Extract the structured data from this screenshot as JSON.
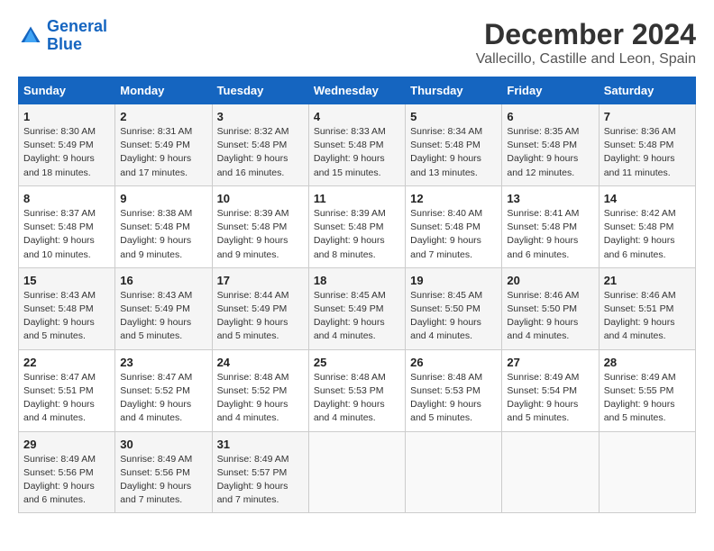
{
  "logo": {
    "line1": "General",
    "line2": "Blue"
  },
  "title": "December 2024",
  "subtitle": "Vallecillo, Castille and Leon, Spain",
  "days_of_week": [
    "Sunday",
    "Monday",
    "Tuesday",
    "Wednesday",
    "Thursday",
    "Friday",
    "Saturday"
  ],
  "weeks": [
    [
      {
        "day": "1",
        "sunrise": "8:30 AM",
        "sunset": "5:49 PM",
        "daylight": "9 hours and 18 minutes."
      },
      {
        "day": "2",
        "sunrise": "8:31 AM",
        "sunset": "5:49 PM",
        "daylight": "9 hours and 17 minutes."
      },
      {
        "day": "3",
        "sunrise": "8:32 AM",
        "sunset": "5:48 PM",
        "daylight": "9 hours and 16 minutes."
      },
      {
        "day": "4",
        "sunrise": "8:33 AM",
        "sunset": "5:48 PM",
        "daylight": "9 hours and 15 minutes."
      },
      {
        "day": "5",
        "sunrise": "8:34 AM",
        "sunset": "5:48 PM",
        "daylight": "9 hours and 13 minutes."
      },
      {
        "day": "6",
        "sunrise": "8:35 AM",
        "sunset": "5:48 PM",
        "daylight": "9 hours and 12 minutes."
      },
      {
        "day": "7",
        "sunrise": "8:36 AM",
        "sunset": "5:48 PM",
        "daylight": "9 hours and 11 minutes."
      }
    ],
    [
      {
        "day": "8",
        "sunrise": "8:37 AM",
        "sunset": "5:48 PM",
        "daylight": "9 hours and 10 minutes."
      },
      {
        "day": "9",
        "sunrise": "8:38 AM",
        "sunset": "5:48 PM",
        "daylight": "9 hours and 9 minutes."
      },
      {
        "day": "10",
        "sunrise": "8:39 AM",
        "sunset": "5:48 PM",
        "daylight": "9 hours and 9 minutes."
      },
      {
        "day": "11",
        "sunrise": "8:39 AM",
        "sunset": "5:48 PM",
        "daylight": "9 hours and 8 minutes."
      },
      {
        "day": "12",
        "sunrise": "8:40 AM",
        "sunset": "5:48 PM",
        "daylight": "9 hours and 7 minutes."
      },
      {
        "day": "13",
        "sunrise": "8:41 AM",
        "sunset": "5:48 PM",
        "daylight": "9 hours and 6 minutes."
      },
      {
        "day": "14",
        "sunrise": "8:42 AM",
        "sunset": "5:48 PM",
        "daylight": "9 hours and 6 minutes."
      }
    ],
    [
      {
        "day": "15",
        "sunrise": "8:43 AM",
        "sunset": "5:48 PM",
        "daylight": "9 hours and 5 minutes."
      },
      {
        "day": "16",
        "sunrise": "8:43 AM",
        "sunset": "5:49 PM",
        "daylight": "9 hours and 5 minutes."
      },
      {
        "day": "17",
        "sunrise": "8:44 AM",
        "sunset": "5:49 PM",
        "daylight": "9 hours and 5 minutes."
      },
      {
        "day": "18",
        "sunrise": "8:45 AM",
        "sunset": "5:49 PM",
        "daylight": "9 hours and 4 minutes."
      },
      {
        "day": "19",
        "sunrise": "8:45 AM",
        "sunset": "5:50 PM",
        "daylight": "9 hours and 4 minutes."
      },
      {
        "day": "20",
        "sunrise": "8:46 AM",
        "sunset": "5:50 PM",
        "daylight": "9 hours and 4 minutes."
      },
      {
        "day": "21",
        "sunrise": "8:46 AM",
        "sunset": "5:51 PM",
        "daylight": "9 hours and 4 minutes."
      }
    ],
    [
      {
        "day": "22",
        "sunrise": "8:47 AM",
        "sunset": "5:51 PM",
        "daylight": "9 hours and 4 minutes."
      },
      {
        "day": "23",
        "sunrise": "8:47 AM",
        "sunset": "5:52 PM",
        "daylight": "9 hours and 4 minutes."
      },
      {
        "day": "24",
        "sunrise": "8:48 AM",
        "sunset": "5:52 PM",
        "daylight": "9 hours and 4 minutes."
      },
      {
        "day": "25",
        "sunrise": "8:48 AM",
        "sunset": "5:53 PM",
        "daylight": "9 hours and 4 minutes."
      },
      {
        "day": "26",
        "sunrise": "8:48 AM",
        "sunset": "5:53 PM",
        "daylight": "9 hours and 5 minutes."
      },
      {
        "day": "27",
        "sunrise": "8:49 AM",
        "sunset": "5:54 PM",
        "daylight": "9 hours and 5 minutes."
      },
      {
        "day": "28",
        "sunrise": "8:49 AM",
        "sunset": "5:55 PM",
        "daylight": "9 hours and 5 minutes."
      }
    ],
    [
      {
        "day": "29",
        "sunrise": "8:49 AM",
        "sunset": "5:56 PM",
        "daylight": "9 hours and 6 minutes."
      },
      {
        "day": "30",
        "sunrise": "8:49 AM",
        "sunset": "5:56 PM",
        "daylight": "9 hours and 7 minutes."
      },
      {
        "day": "31",
        "sunrise": "8:49 AM",
        "sunset": "5:57 PM",
        "daylight": "9 hours and 7 minutes."
      },
      null,
      null,
      null,
      null
    ]
  ],
  "labels": {
    "sunrise": "Sunrise:",
    "sunset": "Sunset:",
    "daylight": "Daylight:"
  }
}
